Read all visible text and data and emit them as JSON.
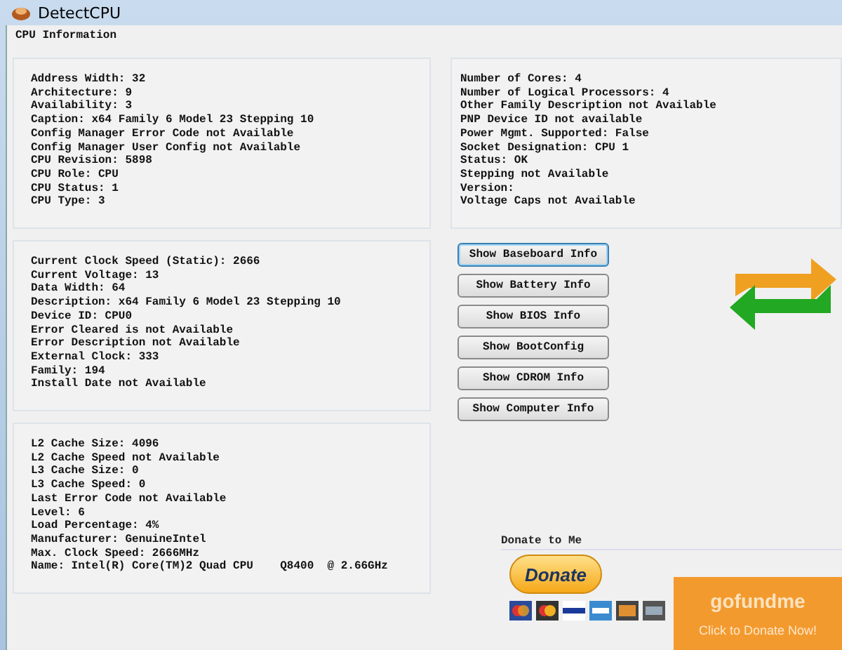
{
  "window": {
    "title": "DetectCPU"
  },
  "group": {
    "label": "CPU Information"
  },
  "panels": [
    {
      "lines": [
        "Address Width: 32",
        "Architecture: 9",
        "Availability: 3",
        "Caption: x64 Family 6 Model 23 Stepping 10",
        "Config Manager Error Code not Available",
        "Config Manager User Config not Available",
        "CPU Revision: 5898",
        "CPU Role: CPU",
        "CPU Status: 1",
        "CPU Type: 3"
      ]
    },
    {
      "lines": [
        "Number of Cores: 4",
        "Number of Logical Processors: 4",
        "Other Family Description not Available",
        "PNP Device ID not available",
        "Power Mgmt. Supported: False",
        "Socket Designation: CPU 1",
        "Status: OK",
        "Stepping not Available",
        "Version:",
        "Voltage Caps not Available"
      ]
    },
    {
      "lines": [
        "Current Clock Speed (Static): 2666",
        "Current Voltage: 13",
        "Data Width: 64",
        "Description: x64 Family 6 Model 23 Stepping 10",
        "Device ID: CPU0",
        "Error Cleared is not Available",
        "Error Description not Available",
        "External Clock: 333",
        "Family: 194",
        "Install Date not Available"
      ]
    },
    {
      "lines": [
        "L2 Cache Size: 4096",
        "L2 Cache Speed not Available",
        "L3 Cache Size: 0",
        "L3 Cache Speed: 0",
        "Last Error Code not Available",
        "Level: 6",
        "Load Percentage: 4%",
        "Manufacturer: GenuineIntel",
        "Max. Clock Speed: 2666MHz",
        "Name: Intel(R) Core(TM)2 Quad CPU    Q8400  @ 2.66GHz"
      ]
    }
  ],
  "buttons": [
    {
      "label": "Show Baseboard Info",
      "focused": true
    },
    {
      "label": "Show Battery Info",
      "focused": false
    },
    {
      "label": "Show BIOS Info",
      "focused": false
    },
    {
      "label": "Show BootConfig",
      "focused": false
    },
    {
      "label": "Show CDROM Info",
      "focused": false
    },
    {
      "label": "Show Computer Info",
      "focused": false
    }
  ],
  "donate": {
    "label": "Donate to Me",
    "button": "Donate",
    "banner_logo": "gofundme",
    "banner_text": "Click to Donate Now!"
  }
}
